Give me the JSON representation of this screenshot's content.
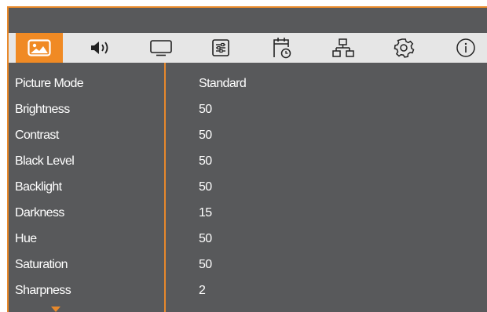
{
  "colors": {
    "accent": "#f08a24",
    "panel": "#58595b",
    "tabbar": "#e6e6e6",
    "text": "#ffffff"
  },
  "tabs": [
    {
      "icon": "picture-icon",
      "active": true
    },
    {
      "icon": "speaker-icon",
      "active": false
    },
    {
      "icon": "monitor-icon",
      "active": false
    },
    {
      "icon": "settings-sliders-icon",
      "active": false
    },
    {
      "icon": "calendar-clock-icon",
      "active": false
    },
    {
      "icon": "network-icon",
      "active": false
    },
    {
      "icon": "gear-icon",
      "active": false
    },
    {
      "icon": "info-icon",
      "active": false
    }
  ],
  "menu": {
    "items": [
      {
        "label": "Picture Mode",
        "value": "Standard"
      },
      {
        "label": "Brightness",
        "value": "50"
      },
      {
        "label": "Contrast",
        "value": "50"
      },
      {
        "label": "Black Level",
        "value": "50"
      },
      {
        "label": "Backlight",
        "value": "50"
      },
      {
        "label": "Darkness",
        "value": "15"
      },
      {
        "label": "Hue",
        "value": "50"
      },
      {
        "label": "Saturation",
        "value": "50"
      },
      {
        "label": "Sharpness",
        "value": "2"
      }
    ],
    "more_indicator": "chevron-down-icon"
  }
}
